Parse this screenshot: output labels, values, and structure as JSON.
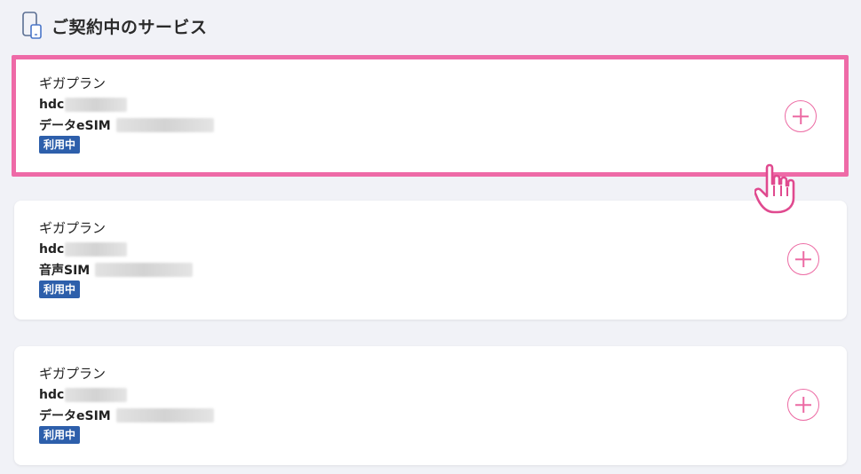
{
  "header": {
    "title": "ご契約中のサービス",
    "icon": "smartphone-icon"
  },
  "services": [
    {
      "plan": "ギガプラン",
      "account_prefix": "hdc",
      "line_type": "データeSIM",
      "status": "利用中",
      "highlighted": true
    },
    {
      "plan": "ギガプラン",
      "account_prefix": "hdc",
      "line_type": "音声SIM",
      "status": "利用中",
      "highlighted": false
    },
    {
      "plan": "ギガプラン",
      "account_prefix": "hdc",
      "line_type": "データeSIM",
      "status": "利用中",
      "highlighted": false
    }
  ],
  "colors": {
    "accent": "#ee6aa7",
    "badge": "#2d5fab",
    "background": "#f1f2f7"
  },
  "pointer": "hand-pointer-icon"
}
